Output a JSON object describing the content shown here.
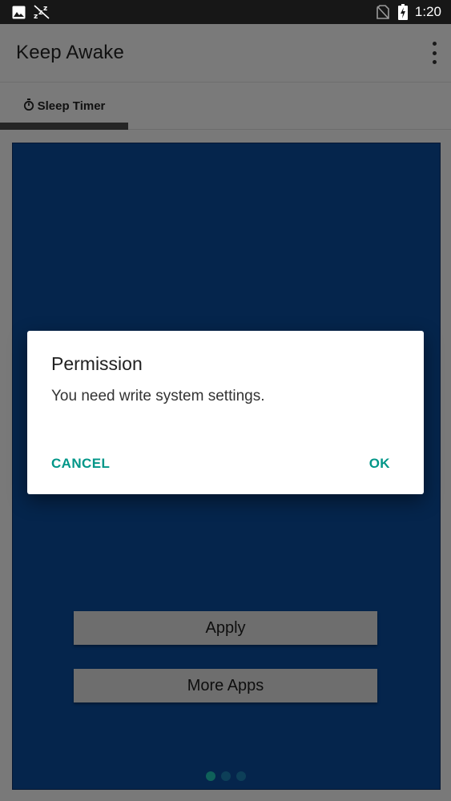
{
  "status_bar": {
    "time": "1:20",
    "icons": [
      "image-icon",
      "do-not-disturb-zzz-icon",
      "no-sim-icon",
      "battery-charging-icon"
    ]
  },
  "app_bar": {
    "title": "Keep Awake",
    "menu_icon": "overflow-menu-icon"
  },
  "tabs": [
    {
      "label": "Sleep Timer",
      "icon": "timer-icon",
      "selected": true
    }
  ],
  "content": {
    "background_color": "#0a4a98",
    "apply_button": "Apply",
    "more_apps_button": "More Apps",
    "page_indicator": {
      "pages": 3,
      "current": 1
    }
  },
  "dialog": {
    "title": "Permission",
    "message": "You need write system settings.",
    "cancel_label": "CANCEL",
    "ok_label": "OK",
    "accent_color": "#009688"
  }
}
